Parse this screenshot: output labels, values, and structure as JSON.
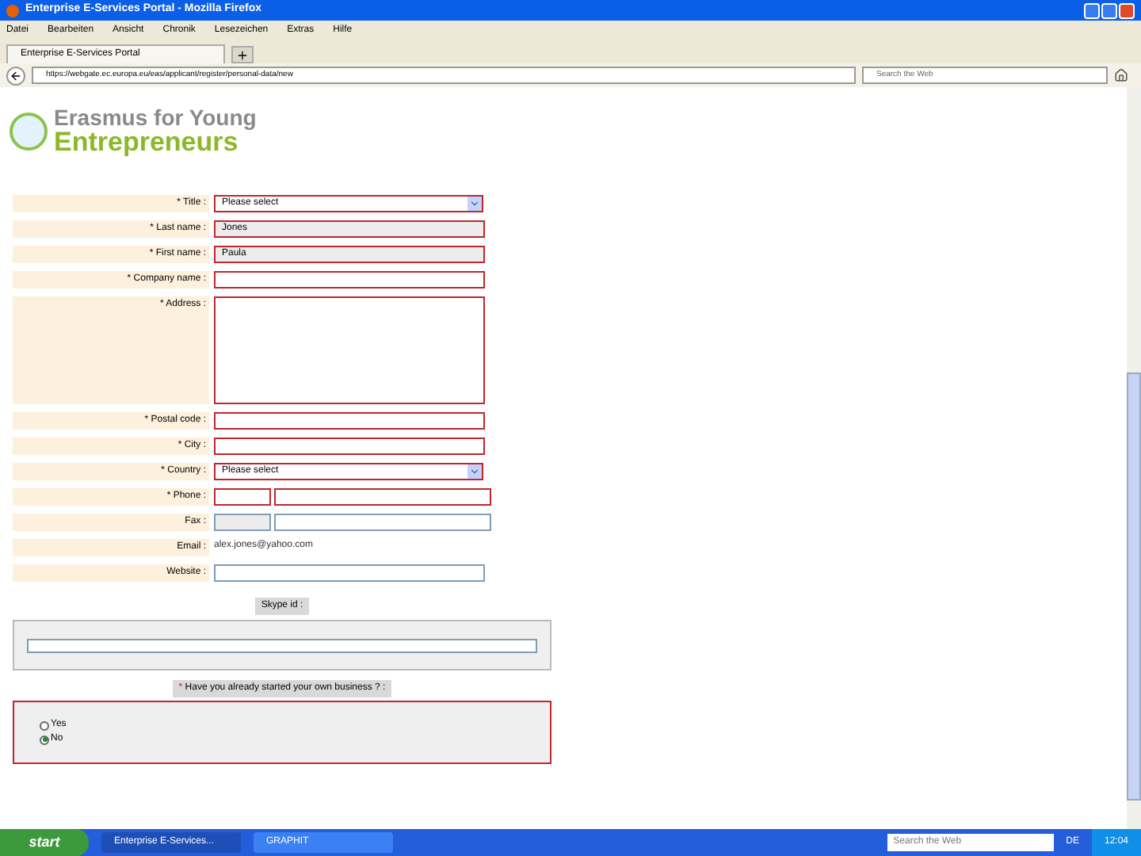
{
  "window": {
    "title": "Enterprise E-Services Portal - Mozilla Firefox"
  },
  "menu": [
    "Datei",
    "Bearbeiten",
    "Ansicht",
    "Chronik",
    "Lesezeichen",
    "Extras",
    "Hilfe"
  ],
  "tabs": [
    {
      "label": "Enterprise E-Services Portal",
      "selected": true
    }
  ],
  "address_bar": {
    "url": "https://webgate.ec.europa.eu/eas/applicant/register/personal-data/new"
  },
  "search_bar": {
    "placeholder": "Search the Web"
  },
  "logo": {
    "line1": "Erasmus for Young",
    "line2": "Entrepreneurs"
  },
  "form": [
    {
      "kind": "select",
      "label": "* Title :",
      "value": "Please select",
      "required": true
    },
    {
      "kind": "text",
      "label": "* Last name :",
      "value": "Jones",
      "readonly": true,
      "required": true
    },
    {
      "kind": "text",
      "label": "* First name :",
      "value": "Paula",
      "readonly": true,
      "required": true
    },
    {
      "kind": "text",
      "label": "* Company name :",
      "required": true
    },
    {
      "kind": "textarea",
      "label": "* Address :",
      "required": true
    },
    {
      "kind": "text",
      "label": "* Postal code :",
      "required": true
    },
    {
      "kind": "text",
      "label": "* City :",
      "required": true
    },
    {
      "kind": "select",
      "label": "* Country :",
      "value": "Please select",
      "required": true
    },
    {
      "kind": "phone",
      "label": "* Phone :",
      "required": true
    },
    {
      "kind": "fax",
      "label": "Fax :",
      "required": false
    },
    {
      "kind": "email",
      "label": "Email :",
      "value": "alex.jones@yahoo.com"
    },
    {
      "kind": "text",
      "label": "Website :",
      "required": false
    }
  ],
  "skype": {
    "label": "Skype id :"
  },
  "business": {
    "asterisk": "*",
    "label": "Have you already started your own business ? :",
    "options": [
      {
        "label": "Yes",
        "selected": false
      },
      {
        "label": "No",
        "selected": true
      }
    ]
  },
  "taskbar": {
    "start": "start",
    "tasks": [
      {
        "label": "Enterprise E-Services...",
        "selected": true
      },
      {
        "label": "GRAPHIT",
        "selected": false
      }
    ],
    "search": "Search the Web",
    "lang": "DE",
    "time": "12:04"
  }
}
